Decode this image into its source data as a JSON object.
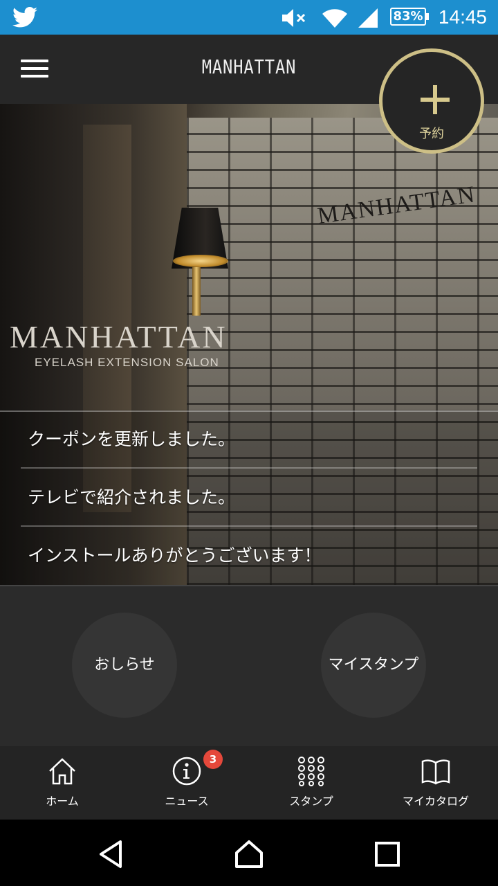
{
  "status_bar": {
    "battery": "83%",
    "time": "14:45",
    "icons": [
      "twitter-icon",
      "mute-icon",
      "wifi-icon",
      "signal-icon",
      "battery-icon"
    ],
    "background": "#1d8fcf"
  },
  "app_bar": {
    "title": "MANHATTAN",
    "menu_icon": "hamburger-menu-icon"
  },
  "fab": {
    "label": "予約",
    "icon": "plus-icon",
    "accent": "#cdbf86"
  },
  "hero": {
    "wall_sign": "MANHATTAN",
    "logo_text": "MANHATTAN",
    "logo_subtitle": "EYELASH EXTENSION SALON"
  },
  "news": [
    {
      "text": "クーポンを更新しました。"
    },
    {
      "text": "テレビで紹介されました。"
    },
    {
      "text": "インストールありがとうございます！"
    }
  ],
  "circle_buttons": {
    "notice": "おしらせ",
    "my_stamp": "マイスタンプ"
  },
  "tabs": [
    {
      "label": "ホーム",
      "icon": "home-icon"
    },
    {
      "label": "ニュース",
      "icon": "info-icon",
      "badge": "3"
    },
    {
      "label": "スタンプ",
      "icon": "grid-dots-icon"
    },
    {
      "label": "マイカタログ",
      "icon": "book-icon"
    }
  ],
  "nav_bar": {
    "icons": [
      "back-icon",
      "home-nav-icon",
      "recents-icon"
    ]
  }
}
